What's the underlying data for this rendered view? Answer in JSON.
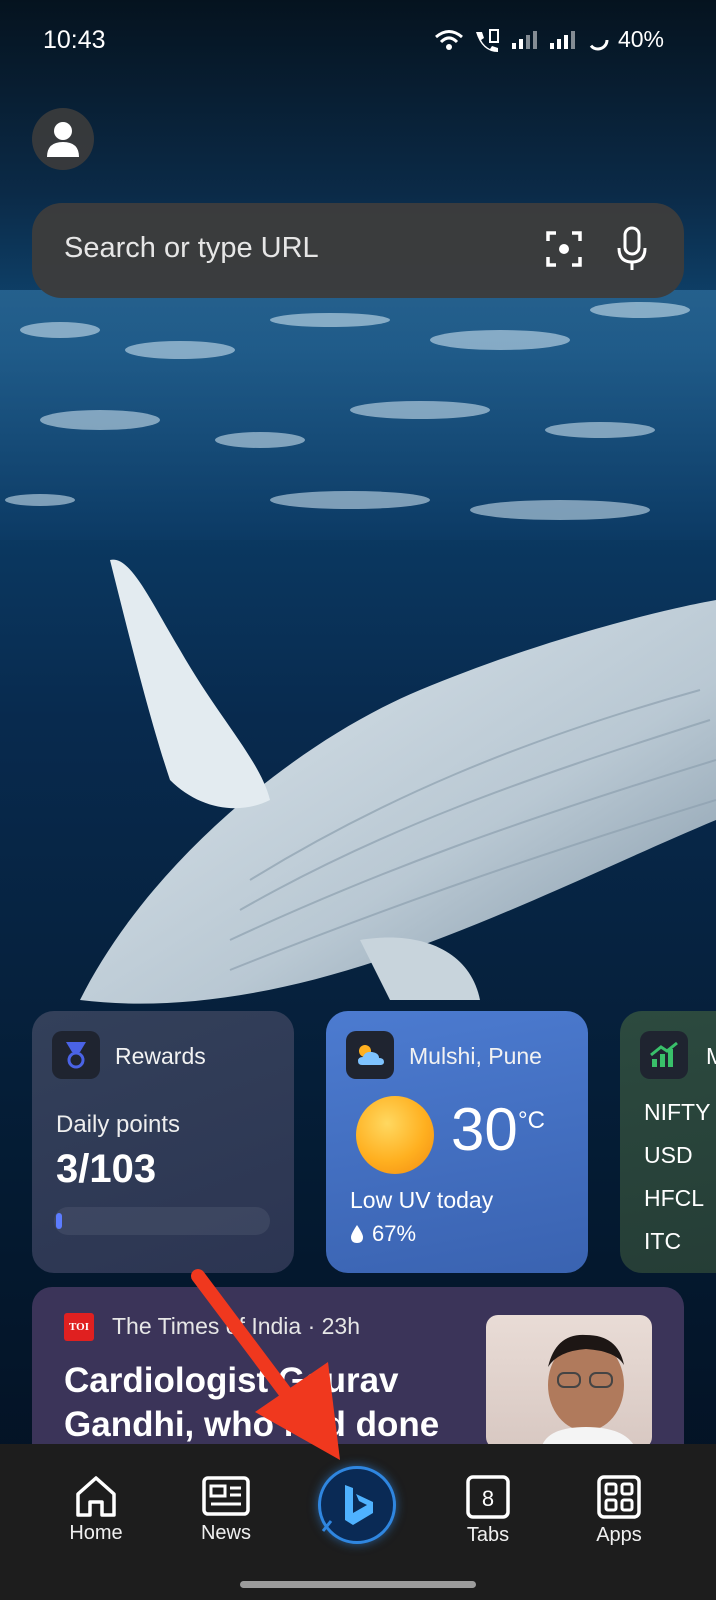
{
  "status_bar": {
    "time": "10:43",
    "battery": "40%"
  },
  "search": {
    "placeholder": "Search or type URL"
  },
  "cards": {
    "rewards": {
      "title": "Rewards",
      "label": "Daily points",
      "value": "3/103",
      "progress": 0.03
    },
    "weather": {
      "location": "Mulshi, Pune",
      "temperature": "30",
      "unit": "°C",
      "uv": "Low UV today",
      "humidity": "67%"
    },
    "market": {
      "title": "M",
      "rows": [
        "NIFTY",
        "USD",
        "HFCL",
        "ITC"
      ]
    }
  },
  "news": {
    "source_logo": "TOI",
    "source": "The Times of India · 23h",
    "headline": "Cardiologist Gaurav Gandhi, who had done"
  },
  "nav": {
    "home": "Home",
    "news": "News",
    "tabs": "Tabs",
    "tabs_count": "8",
    "apps": "Apps"
  },
  "colors": {
    "accent": "#2f86e0",
    "arrow": "#f0381e"
  }
}
